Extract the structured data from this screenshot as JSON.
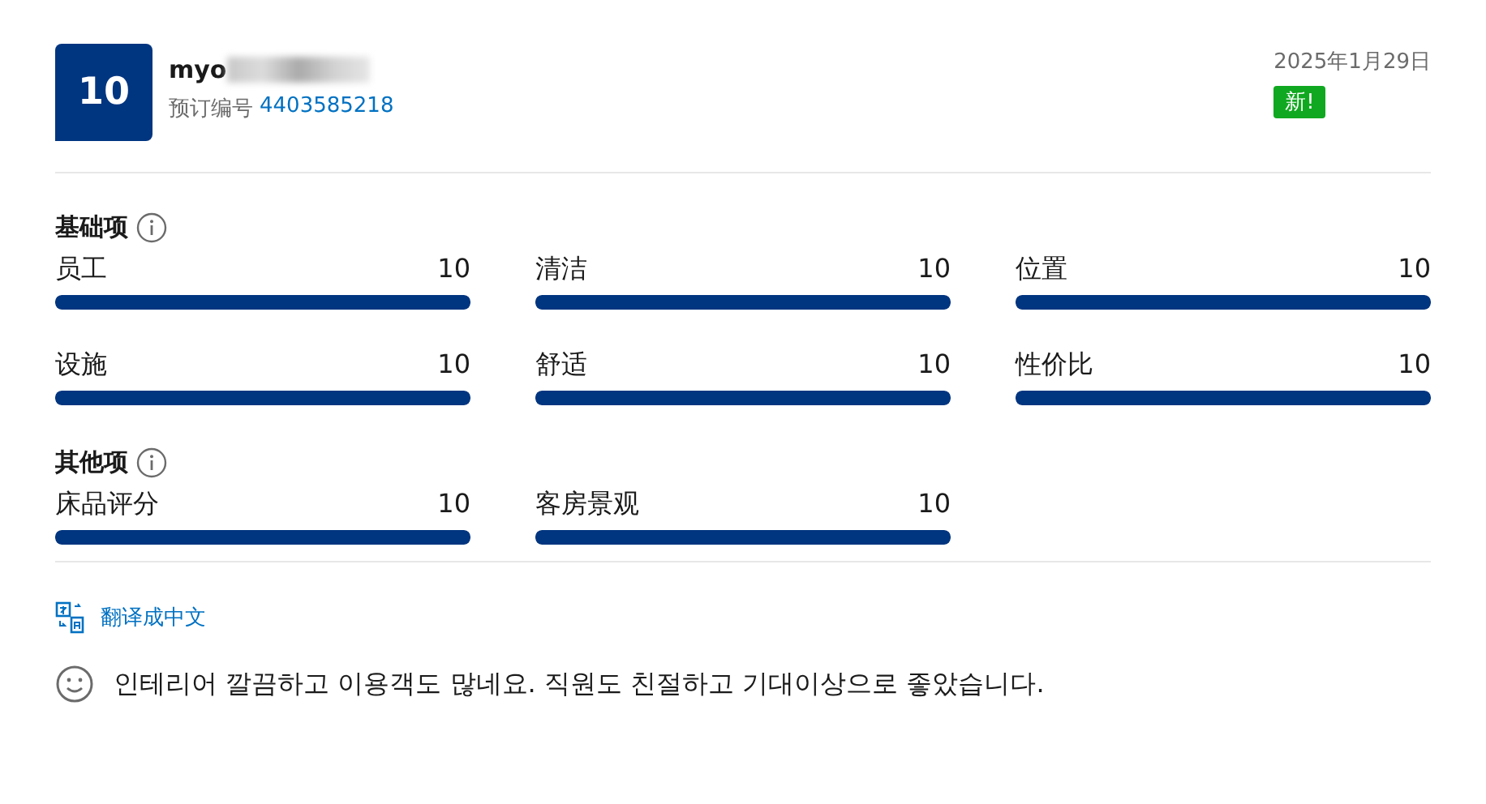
{
  "review": {
    "score": "10",
    "user_name": "myo",
    "booking_label": "预订编号",
    "booking_number": "4403585218",
    "date": "2025年1月29日",
    "badge": "新!"
  },
  "sections": [
    {
      "title": "基础项",
      "ratings": [
        {
          "label": "员工",
          "value": "10",
          "level": 1
        },
        {
          "label": "清洁",
          "value": "10",
          "level": 1
        },
        {
          "label": "位置",
          "value": "10",
          "level": 1
        },
        {
          "label": "设施",
          "value": "10",
          "level": 1
        },
        {
          "label": "舒适",
          "value": "10",
          "level": 1
        },
        {
          "label": "性价比",
          "value": "10",
          "level": 1
        }
      ]
    },
    {
      "title": "其他项",
      "ratings": [
        {
          "label": "床品评分",
          "value": "10",
          "level": 1
        },
        {
          "label": "客房景观",
          "value": "10",
          "level": 1
        }
      ]
    }
  ],
  "translate_link": "翻译成中文",
  "comment": "인테리어 깔끔하고 이용객도 많네요. 직원도 친절하고 기대이상으로 좋았습니다."
}
